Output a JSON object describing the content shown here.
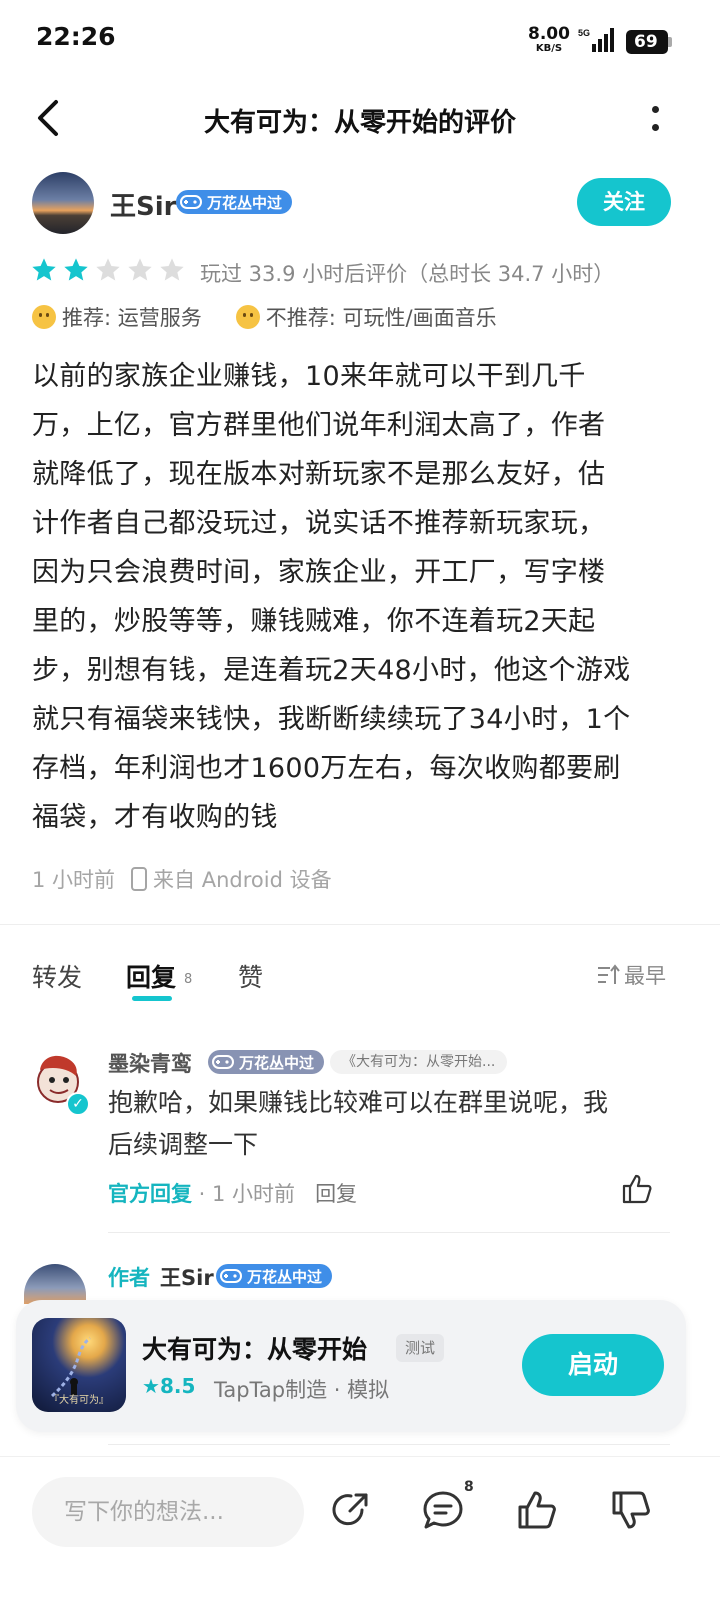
{
  "status_bar": {
    "time": "22:26",
    "net_speed_value": "8.00",
    "net_speed_unit": "KB/S",
    "network": "5G",
    "battery": "69"
  },
  "header": {
    "title": "大有可为：从零开始的评价"
  },
  "author": {
    "name": "王Sir",
    "badge": "万花丛中过",
    "follow_label": "关注"
  },
  "rating": {
    "stars": 2,
    "max_stars": 5,
    "played_text": "玩过 33.9 小时后评价（总时长 34.7 小时）",
    "recommend": "推荐: 运营服务",
    "not_recommend": "不推荐: 可玩性/画面音乐"
  },
  "review": {
    "lines": [
      "以前的家族企业赚钱，10来年就可以干到几千",
      "万，上亿，官方群里他们说年利润太高了，作者",
      "就降低了，现在版本对新玩家不是那么友好，估",
      "计作者自己都没玩过，说实话不推荐新玩家玩，",
      "因为只会浪费时间，家族企业，开工厂，写字楼",
      "里的，炒股等等，赚钱贼难，你不连着玩2天起",
      "步，别想有钱，是连着玩2天48小时，他这个游戏",
      "就只有福袋来钱快，我断断续续玩了34小时，1个",
      "存档，年利润也才1600万左右，每次收购都要刷",
      "福袋，才有收购的钱"
    ],
    "time": "1 小时前",
    "device": "来自 Android 设备"
  },
  "tabs": {
    "forward": "转发",
    "reply": "回复",
    "reply_count": "8",
    "like": "赞",
    "sort": "最早"
  },
  "comments": [
    {
      "name": "墨染青鸾",
      "badge": "万花丛中过",
      "ref": "《大有可为：从零开始...",
      "text_lines": [
        "抱歉哈，如果赚钱比较难可以在群里说呢，我",
        "后续调整一下"
      ],
      "official": "官方回复",
      "time": " · 1 小时前",
      "reply_label": "回复"
    },
    {
      "author_tag": "作者",
      "name": "王Sir",
      "badge": "万花丛中过"
    }
  ],
  "game_card": {
    "title": "大有可为：从零开始",
    "tag": "测试",
    "rating": "8.5",
    "subtitle": "TapTap制造 · 模拟",
    "icon_caption": "『大有可为』",
    "launch_label": "启动"
  },
  "bottom_bar": {
    "placeholder": "写下你的想法...",
    "comment_count": "8"
  },
  "colors": {
    "accent": "#15c5ce",
    "badge_blue": "#3f8ee8",
    "star_on": "#15c5ce",
    "star_off": "#dddddd"
  }
}
